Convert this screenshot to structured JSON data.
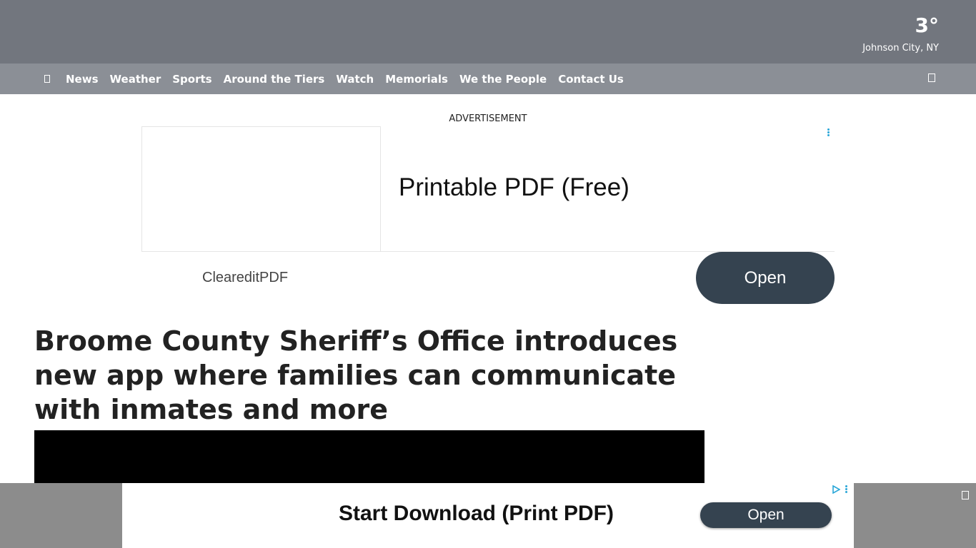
{
  "header": {
    "temperature": "3°",
    "location": "Johnson City, NY"
  },
  "nav": {
    "menu_icon": "menu-icon",
    "items": [
      "News",
      "Weather",
      "Sports",
      "Around the Tiers",
      "Watch",
      "Memorials",
      "We the People",
      "Contact Us"
    ],
    "search_icon": "search-icon"
  },
  "ad_top": {
    "label": "ADVERTISEMENT",
    "headline": "Printable PDF (Free)",
    "brand": "CleareditPDF",
    "button": "Open"
  },
  "article": {
    "headline": "Broome County Sheriff’s Office introduces new app where families can communicate with inmates and more"
  },
  "ad_bottom": {
    "text": "Start Download (Print PDF)",
    "button": "Open",
    "accent_color": "#354350"
  }
}
